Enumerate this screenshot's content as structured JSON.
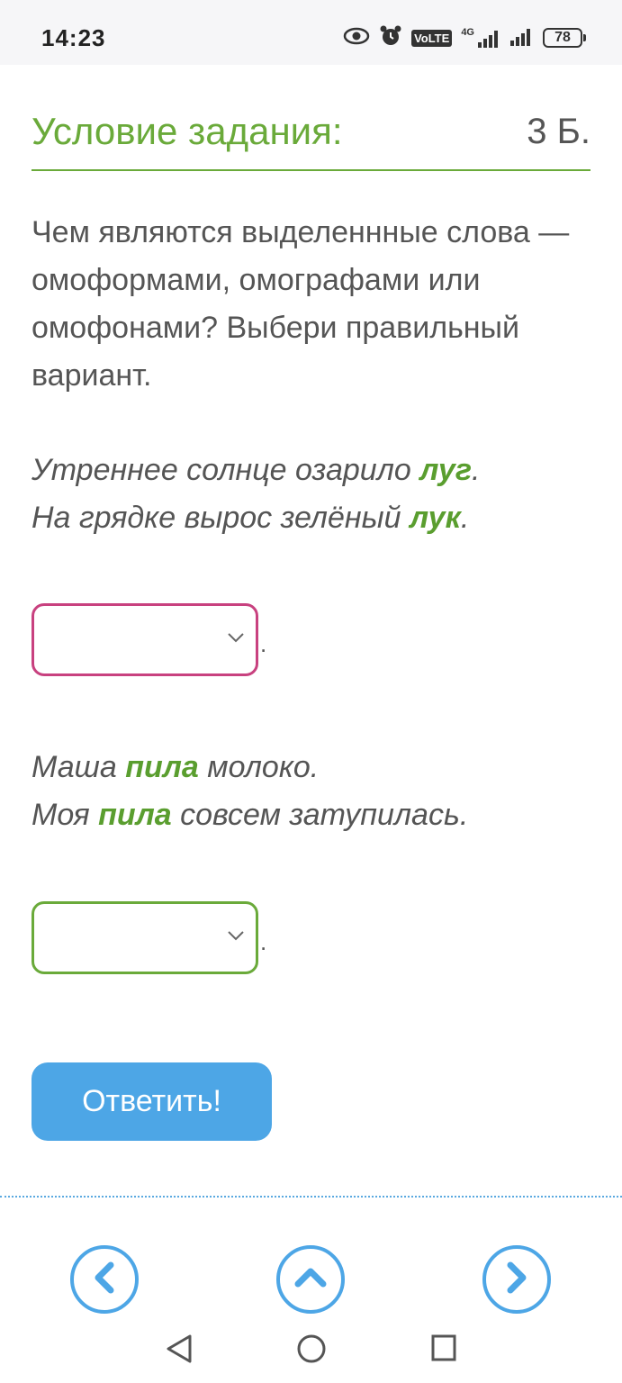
{
  "status_bar": {
    "time": "14:23",
    "volte_label": "VoLTE",
    "network_label": "4G",
    "battery": "78",
    "icons": [
      "eye-icon",
      "alarm-icon",
      "volte-icon",
      "signal-icon",
      "signal-icon",
      "battery-icon"
    ]
  },
  "header": {
    "title": "Условие задания:",
    "points": "3 Б.",
    "accent_color": "#6aaa3a"
  },
  "question": {
    "text": "Чем являются выделеннные слова — омоформами, омографами или омофонами? Выбери правильный вариант."
  },
  "block1": {
    "line1": {
      "before": "Утреннее солнце озарило ",
      "highlight": "луг",
      "after": "."
    },
    "line2": {
      "before": "На грядке вырос зелёный ",
      "highlight": "лук",
      "after": "."
    },
    "select_value": "",
    "border_color": "#c8417f"
  },
  "block2": {
    "line1": {
      "before": "Маша ",
      "highlight": "пила",
      "after": " молоко."
    },
    "line2": {
      "before": "Моя ",
      "highlight": "пила",
      "after": " совсем затупилась."
    },
    "select_value": "",
    "border_color": "#6aaa3a"
  },
  "dropdown_suffix": ".",
  "answer_button": {
    "label": "Ответить!",
    "color": "#4da6e6"
  },
  "nav": {
    "icons": [
      "chevron-left-icon",
      "chevron-up-icon",
      "chevron-right-icon"
    ]
  },
  "system_nav": {
    "icons": [
      "back-triangle-icon",
      "home-circle-icon",
      "recents-square-icon"
    ]
  }
}
